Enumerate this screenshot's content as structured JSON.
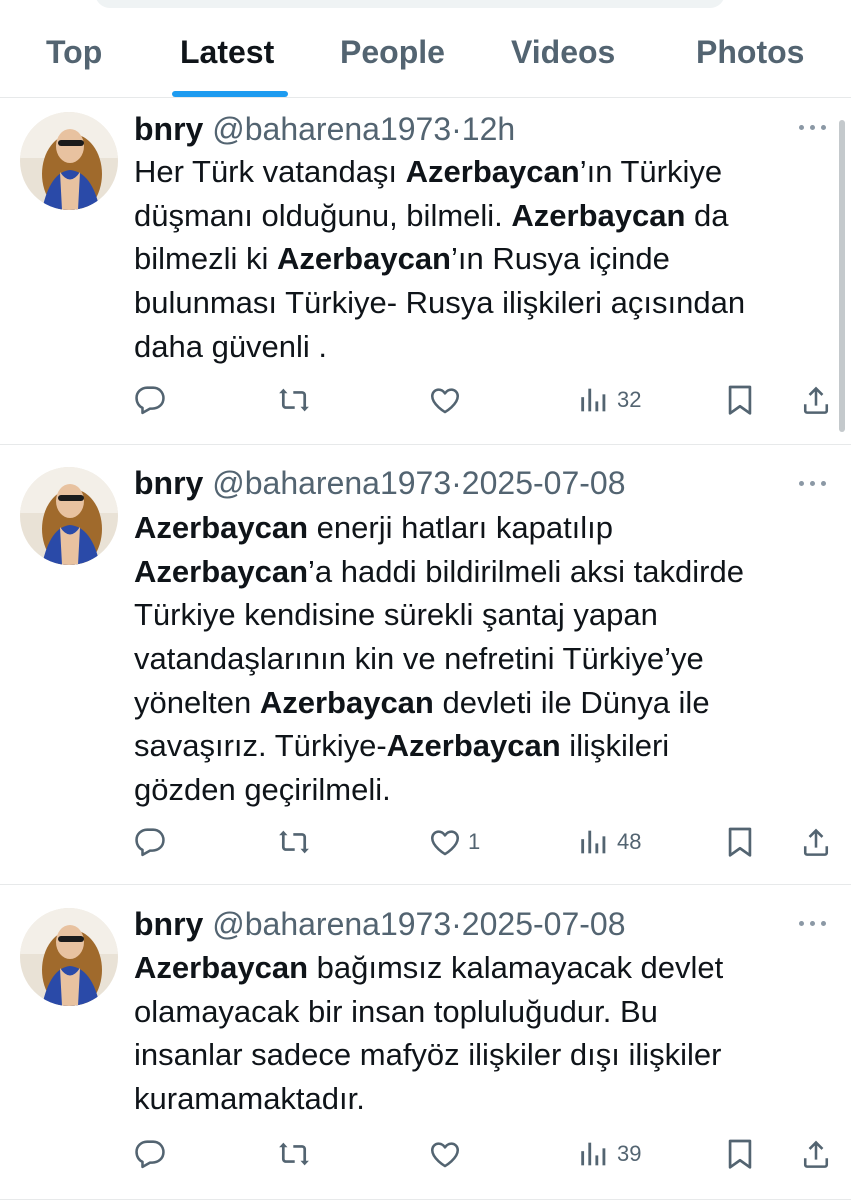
{
  "tabs": [
    {
      "label": "Top"
    },
    {
      "label": "Latest",
      "active": true
    },
    {
      "label": "People"
    },
    {
      "label": "Videos"
    },
    {
      "label": "Photos"
    }
  ],
  "colors": {
    "accent": "#1d9bf0",
    "secondary_text": "#536471",
    "primary_text": "#0f1419",
    "divider": "#e7e9ea"
  },
  "tweets": [
    {
      "name": "bnry",
      "handle": "@baharena1973",
      "dot": "·",
      "time": "12h",
      "lines": [
        [
          {
            "t": "Her Türk vatandaşı "
          },
          {
            "t": "Azerbaycan",
            "b": true
          },
          {
            "t": "’ın Türkiye"
          }
        ],
        [
          {
            "t": "düşmanı olduğunu,  bilmeli. "
          },
          {
            "t": "Azerbaycan",
            "b": true
          },
          {
            "t": " da"
          }
        ],
        [
          {
            "t": "bilmezli ki "
          },
          {
            "t": "Azerbaycan",
            "b": true
          },
          {
            "t": "’ın Rusya içinde"
          }
        ],
        [
          {
            "t": "bulunması Türkiye- Rusya ilişkileri açısından"
          }
        ],
        [
          {
            "t": "daha güvenli ."
          }
        ]
      ],
      "likes": "",
      "views": "32"
    },
    {
      "name": "bnry",
      "handle": "@baharena1973",
      "dot": "·",
      "time": "2025-07-08",
      "lines": [
        [
          {
            "t": "Azerbaycan",
            "b": true
          },
          {
            "t": " enerji hatları kapatılıp"
          }
        ],
        [
          {
            "t": "Azerbaycan",
            "b": true
          },
          {
            "t": "’a haddi bildirilmeli aksi takdirde"
          }
        ],
        [
          {
            "t": "Türkiye kendisine sürekli şantaj yapan"
          }
        ],
        [
          {
            "t": "vatandaşlarının kin ve nefretini Türkiye’ye"
          }
        ],
        [
          {
            "t": "yönelten "
          },
          {
            "t": "Azerbaycan",
            "b": true
          },
          {
            "t": " devleti ile Dünya ile"
          }
        ],
        [
          {
            "t": "savaşırız. Türkiye-"
          },
          {
            "t": "Azerbaycan",
            "b": true
          },
          {
            "t": "  ilişkileri"
          }
        ],
        [
          {
            "t": "gözden geçirilmeli."
          }
        ]
      ],
      "likes": "1",
      "views": "48"
    },
    {
      "name": "bnry",
      "handle": "@baharena1973",
      "dot": "·",
      "time": "2025-07-08",
      "lines": [
        [
          {
            "t": "Azerbaycan",
            "b": true
          },
          {
            "t": " bağımsız kalamayacak devlet"
          }
        ],
        [
          {
            "t": "olamayacak bir insan topluluğudur. Bu"
          }
        ],
        [
          {
            "t": "insanlar sadece mafyöz ilişkiler dışı ilişkiler"
          }
        ],
        [
          {
            "t": "kuramamaktadır."
          }
        ]
      ],
      "likes": "",
      "views": "39"
    }
  ],
  "icons": [
    "reply-icon",
    "retweet-icon",
    "like-icon",
    "views-icon",
    "bookmark-icon",
    "share-icon",
    "more-icon"
  ]
}
